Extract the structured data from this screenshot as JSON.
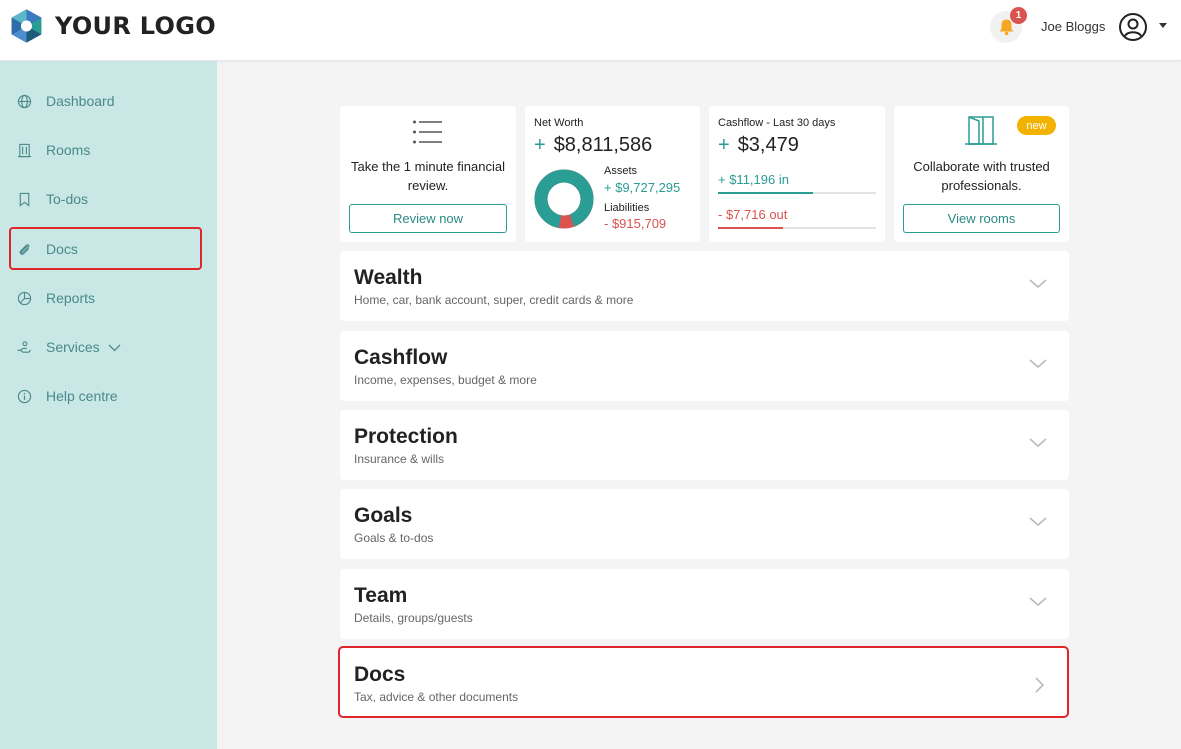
{
  "header": {
    "logo_text": "YOUR LOGO",
    "notification_count": "1",
    "user_name": "Joe Bloggs"
  },
  "sidebar": {
    "items": [
      {
        "label": "Dashboard",
        "icon": "globe-icon"
      },
      {
        "label": "Rooms",
        "icon": "building-icon"
      },
      {
        "label": "To-dos",
        "icon": "bookmark-icon"
      },
      {
        "label": "Docs",
        "icon": "paperclip-icon"
      },
      {
        "label": "Reports",
        "icon": "pie-chart-icon"
      },
      {
        "label": "Services",
        "icon": "hand-icon"
      },
      {
        "label": "Help centre",
        "icon": "info-icon"
      }
    ]
  },
  "cards": {
    "review": {
      "text": "Take the 1 minute financial review.",
      "button": "Review now"
    },
    "net_worth": {
      "label": "Net Worth",
      "value": "$8,811,586",
      "assets_label": "Assets",
      "assets_value": "+ $9,727,295",
      "liabilities_label": "Liabilities",
      "liabilities_value": "- $915,709",
      "assets_fraction": 0.914
    },
    "cashflow": {
      "label": "Cashflow - Last 30 days",
      "value": "$3,479",
      "in_value": "+ $11,196",
      "in_label": "in",
      "out_value": "- $7,716",
      "out_label": "out",
      "in_fraction": 0.6,
      "out_fraction": 0.41
    },
    "rooms": {
      "badge": "new",
      "text": "Collaborate with trusted professionals.",
      "button": "View rooms"
    }
  },
  "sections": [
    {
      "title": "Wealth",
      "subtitle": "Home, car, bank account, super, credit cards & more"
    },
    {
      "title": "Cashflow",
      "subtitle": "Income, expenses, budget & more"
    },
    {
      "title": "Protection",
      "subtitle": "Insurance & wills"
    },
    {
      "title": "Goals",
      "subtitle": "Goals & to-dos"
    },
    {
      "title": "Team",
      "subtitle": "Details, groups/guests"
    },
    {
      "title": "Docs",
      "subtitle": "Tax, advice & other documents"
    }
  ],
  "colors": {
    "teal": "#2a9d94",
    "sidebar_bg": "#c8e7e5",
    "red": "#d9534f",
    "badge_yellow": "#f2b200",
    "highlight": "#e0262b"
  }
}
